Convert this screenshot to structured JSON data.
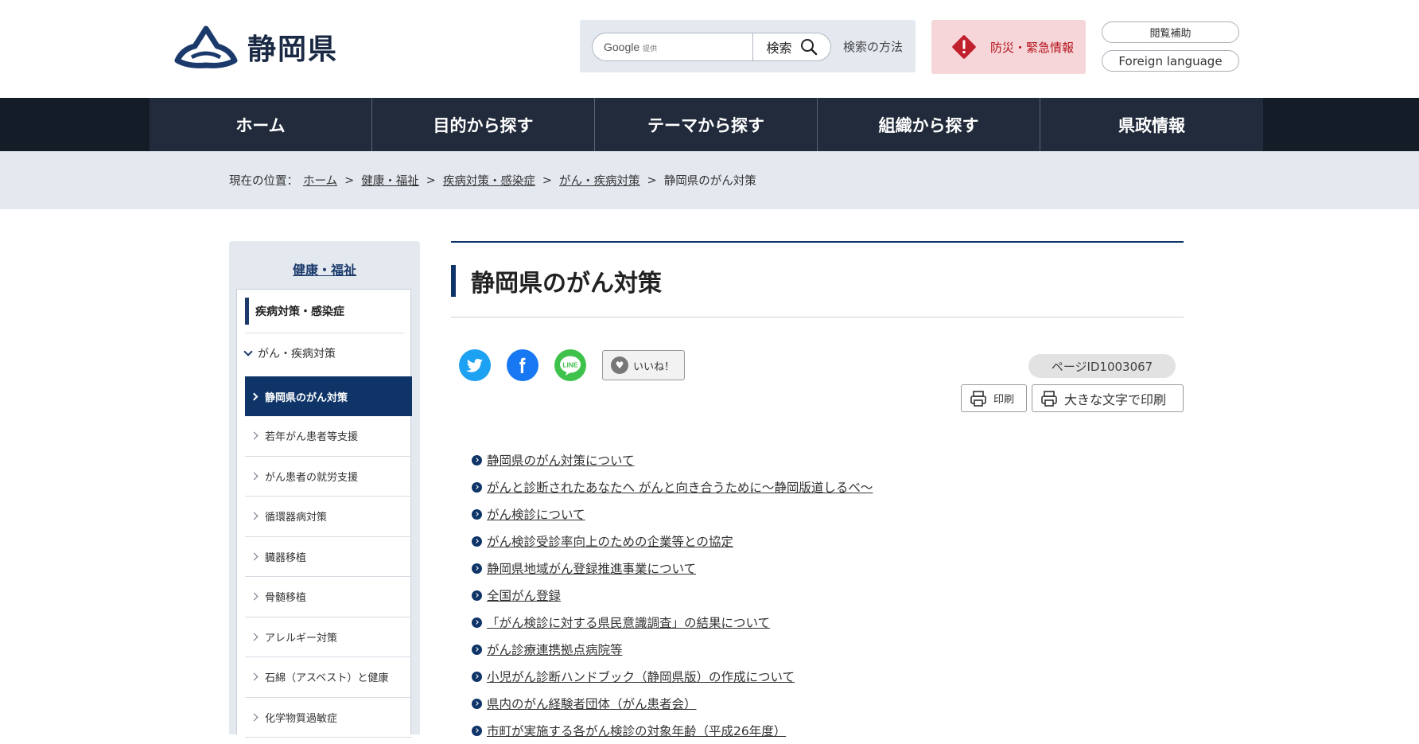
{
  "header": {
    "logo_text": "静岡県",
    "search": {
      "google_label": "Google",
      "google_sub": "提供",
      "button_label": "検索",
      "method_label": "検索の方法"
    },
    "disaster_label": "防災・緊急情報",
    "browse_assist_label": "閲覧補助",
    "foreign_language_label": "Foreign language"
  },
  "nav": {
    "items": [
      "ホーム",
      "目的から探す",
      "テーマから探す",
      "組織から探す",
      "県政情報"
    ]
  },
  "breadcrumb": {
    "prefix": "現在の位置：",
    "items": [
      "ホーム",
      "健康・福祉",
      "疾病対策・感染症",
      "がん・疾病対策"
    ],
    "current": "静岡県のがん対策",
    "separator": ">"
  },
  "sidebar": {
    "title": "健康・福祉",
    "section": "疾病対策・感染症",
    "sub": "がん・疾病対策",
    "active": "静岡県のがん対策",
    "items": [
      "若年がん患者等支援",
      "がん患者の就労支援",
      "循環器病対策",
      "臓器移植",
      "骨髄移植",
      "アレルギー対策",
      "石綿（アスベスト）と健康",
      "化学物質過敏症"
    ]
  },
  "main": {
    "title": "静岡県のがん対策",
    "like_label": "いいね！",
    "page_id": "ページID1003067",
    "print_label": "印刷",
    "print_large_label": "大きな文字で印刷",
    "links": [
      "静岡県のがん対策について",
      "がんと診断されたあなたへ がんと向き合うために～静岡版道しるべ～",
      "がん検診について",
      "がん検診受診率向上のための企業等との協定",
      "静岡県地域がん登録推進事業について",
      "全国がん登録",
      "「がん検診に対する県民意識調査」の結果について",
      "がん診療連携拠点病院等",
      "小児がん診断ハンドブック（静岡県版）の作成について",
      "県内のがん経験者団体（がん患者会）",
      "市町が実施する各がん検診の対象年齢（平成26年度）"
    ]
  },
  "colors": {
    "navy": "#0e3468",
    "nav_bg": "#212b3b",
    "crumb_bg": "#e4e9f0",
    "disaster_bg": "#f6d6d9",
    "disaster_text": "#b5121b"
  }
}
